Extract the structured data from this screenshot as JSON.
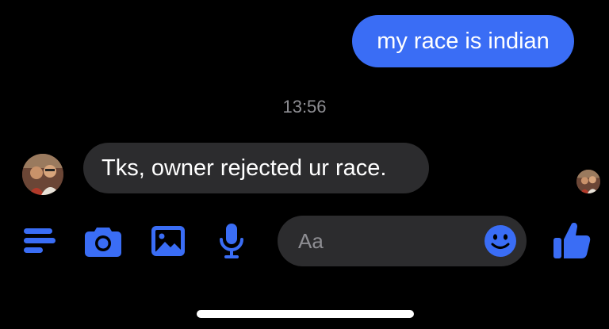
{
  "messages": {
    "sent_text": "my race is indian",
    "timestamp": "13:56",
    "received_text": "Tks, owner rejected ur race."
  },
  "composer": {
    "placeholder": "Aa"
  },
  "icons": {
    "menu": "menu-icon",
    "camera": "camera-icon",
    "gallery": "image-icon",
    "microphone": "mic-icon",
    "emoji": "emoji-icon",
    "like": "thumbs-up-icon",
    "avatar": "avatar"
  },
  "colors": {
    "accent": "#3a6df5",
    "background": "#000000",
    "received_bubble": "#2c2c2e",
    "timestamp": "#8e8e93"
  }
}
